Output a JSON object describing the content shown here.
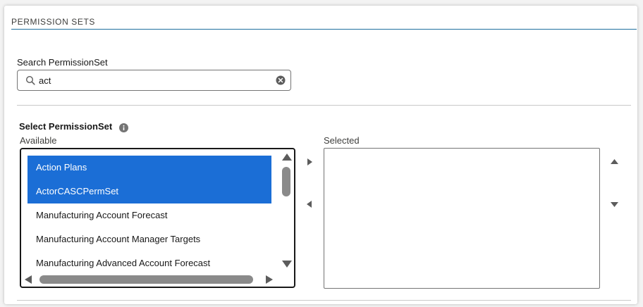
{
  "section": {
    "title": "PERMISSION SETS"
  },
  "search": {
    "label": "Search PermissionSet",
    "value": "act",
    "placeholder": ""
  },
  "dual_listbox": {
    "title": "Select PermissionSet",
    "available_label": "Available",
    "selected_label": "Selected",
    "available_options": [
      {
        "label": "Action Plans",
        "selected": true
      },
      {
        "label": "ActorCASCPermSet",
        "selected": true
      },
      {
        "label": "Manufacturing Account Forecast",
        "selected": false
      },
      {
        "label": "Manufacturing Account Manager Targets",
        "selected": false
      },
      {
        "label": "Manufacturing Advanced Account Forecast",
        "selected": false
      }
    ],
    "selected_options": []
  },
  "colors": {
    "accent": "#1b6ed6",
    "section_rule": "#1f6f9f"
  },
  "icons": {
    "search": "search-icon",
    "clear": "clear-icon",
    "info": "info-icon",
    "move_right": "caret-right-icon",
    "move_left": "caret-left-icon",
    "move_up": "caret-up-icon",
    "move_down": "caret-down-icon"
  }
}
